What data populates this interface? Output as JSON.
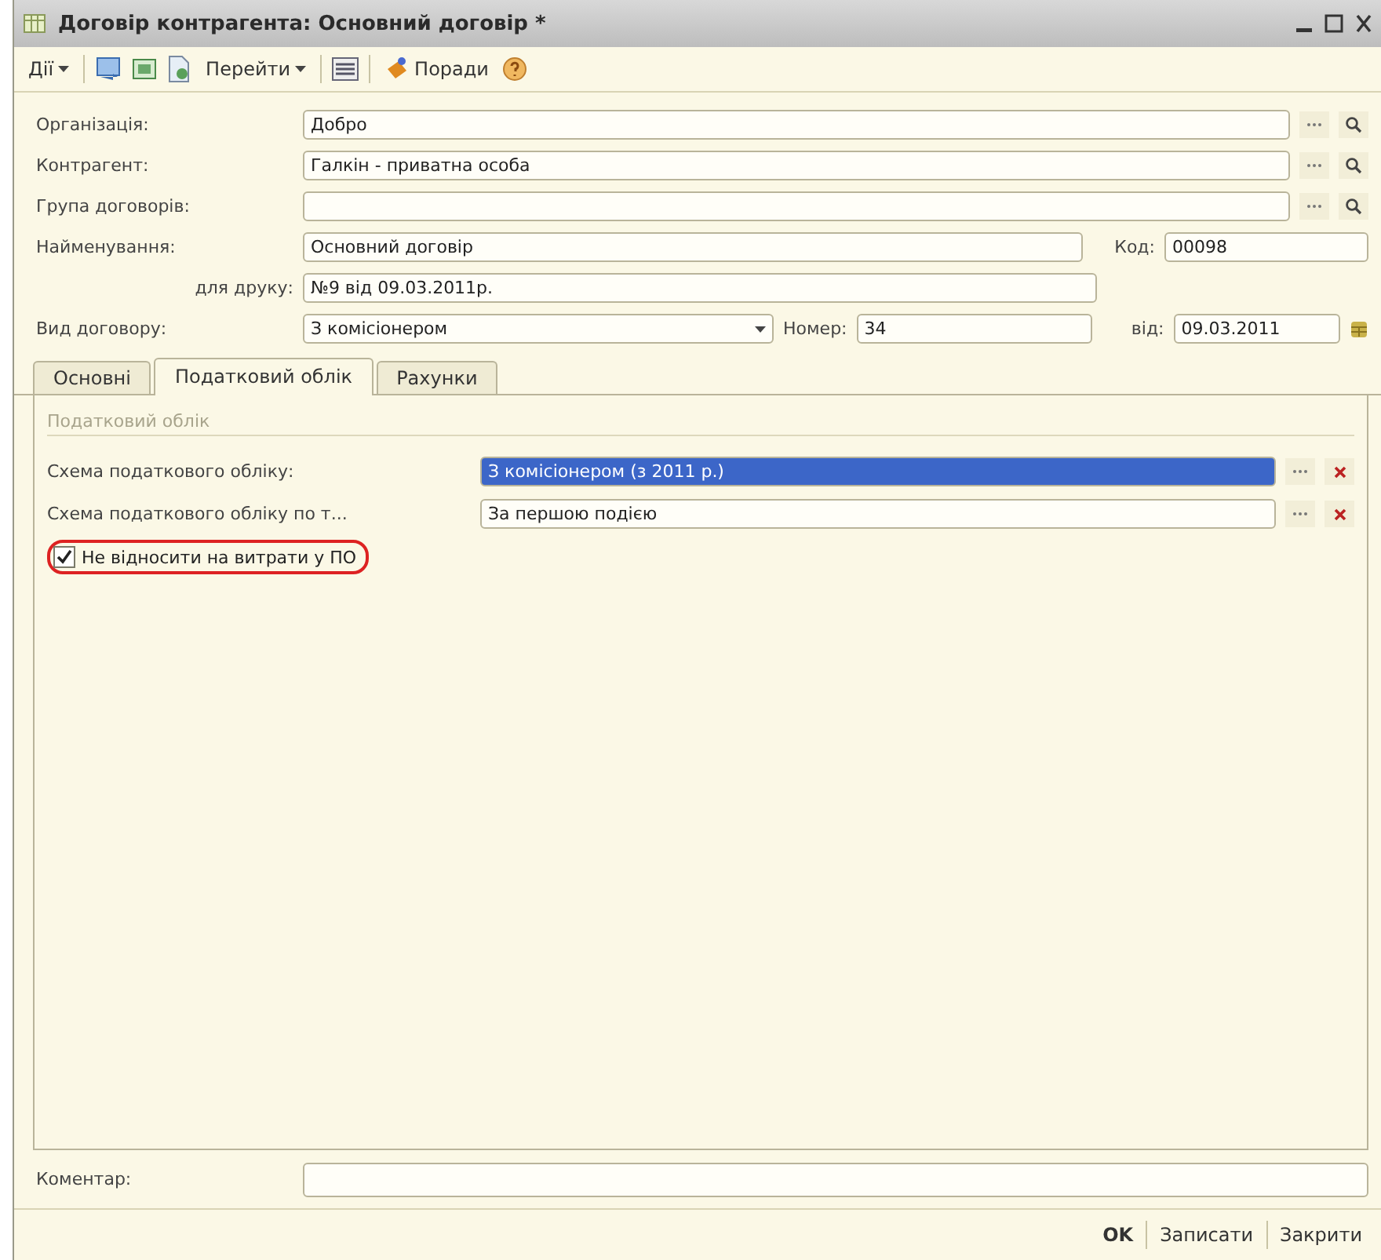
{
  "window": {
    "title": "Договір контрагента: Основний договір *"
  },
  "toolbar": {
    "actions_menu": "Дії",
    "goto_menu": "Перейти",
    "tips": "Поради"
  },
  "header_fields": [
    {
      "kind": "lookup",
      "label": "Організація:",
      "value": "Добро"
    },
    {
      "kind": "lookup",
      "label": "Контрагент:",
      "value": "Галкін - приватна особа"
    },
    {
      "kind": "lookup",
      "label": "Група договорів:"
    },
    {
      "kind": "code",
      "label": "Найменування:",
      "value": "Основний договір",
      "extra_label": "Код:",
      "extra_value": "00098"
    },
    {
      "kind": "text",
      "label": "для друку:",
      "value": "№9 від 09.03.2011р."
    },
    {
      "kind": "dropdown",
      "label": "Вид договору:",
      "value": "З комісіонером",
      "number_label": "Номер:",
      "number_value": "34",
      "date_label": "від:",
      "date_value": "09.03.2011"
    }
  ],
  "tabs": [
    {
      "label": "Основні",
      "selected": false
    },
    {
      "label": "Податковий облік",
      "selected": true
    },
    {
      "label": "Рахунки",
      "selected": false
    }
  ],
  "tax_panel": {
    "group_title": "Податковий облік",
    "fields": [
      {
        "label": "Схема податкового обліку:",
        "value": "З комісіонером (з 2011 р.)",
        "selected": true
      },
      {
        "label": "Схема податкового обліку по т...",
        "value": "За першою подією",
        "selected": false
      }
    ],
    "checkbox": {
      "label": "Не відносити на витрати у ПО",
      "checked": true,
      "highlighted": true
    }
  },
  "comment": {
    "label": "Коментар:"
  },
  "buttons": [
    {
      "label": "OK",
      "primary": true
    },
    {
      "label": "Записати",
      "primary": false
    },
    {
      "label": "Закрити",
      "primary": false
    }
  ]
}
